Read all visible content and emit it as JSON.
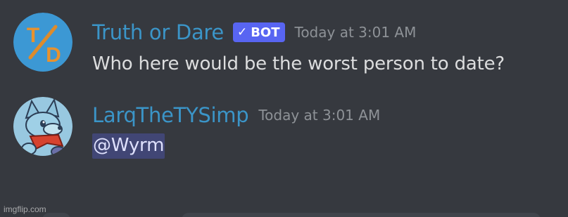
{
  "messages": [
    {
      "username": "Truth or Dare",
      "bot_tag": "BOT",
      "timestamp": "Today at 3:01 AM",
      "text": "Who here would be the worst person to date?",
      "avatar_icon": "truth-or-dare-avatar"
    },
    {
      "username": "LarqTheTYSimp",
      "timestamp": "Today at 3:01 AM",
      "mention": "@Wyrm",
      "avatar_icon": "wolf-avatar"
    }
  ],
  "watermark": "imgflip.com",
  "colors": {
    "background": "#36393f",
    "username": "#3b95c8",
    "bot_tag": "#5865f2",
    "timestamp": "#8e9297",
    "message_text": "#dcddde",
    "mention_bg": "#414675"
  }
}
